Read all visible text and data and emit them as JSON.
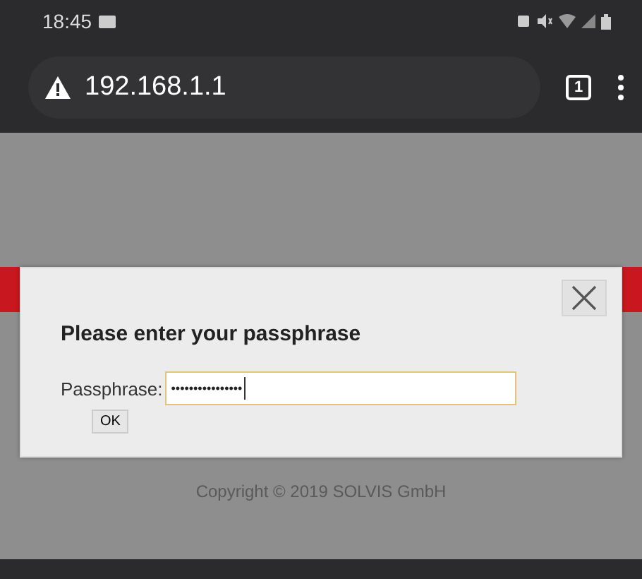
{
  "status_bar": {
    "time": "18:45"
  },
  "address_bar": {
    "url": "192.168.1.1",
    "tab_count": "1"
  },
  "dialog": {
    "title": "Please enter your passphrase",
    "field_label": "Passphrase:",
    "field_value": "••••••••••••••••",
    "button": "OK"
  },
  "footer": {
    "copyright": "Copyright © 2019 SOLVIS GmbH"
  }
}
